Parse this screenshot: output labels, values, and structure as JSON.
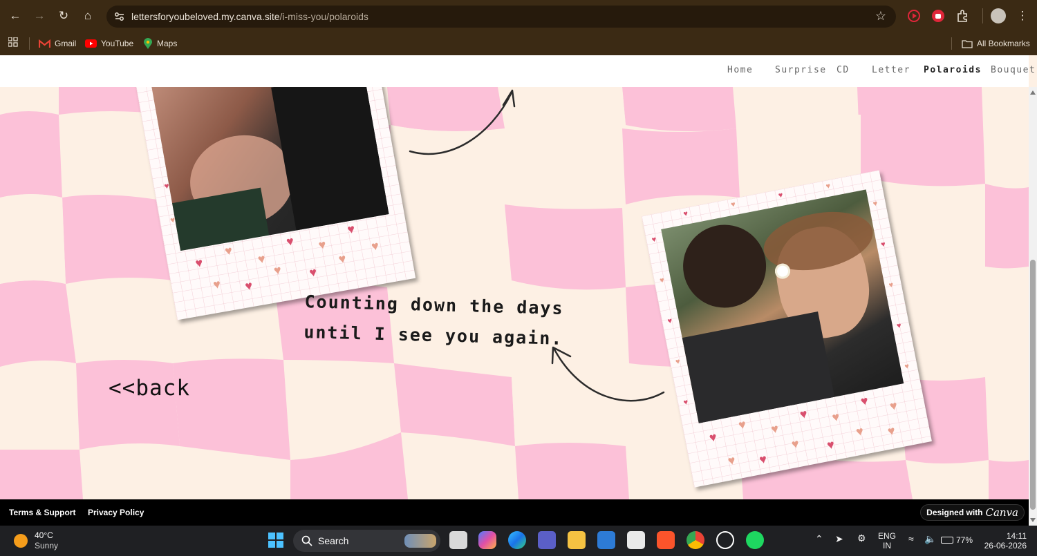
{
  "browser": {
    "url_host": "lettersforyoubeloved.my.canva.site",
    "url_path": "/i-miss-you/polaroids",
    "bookmarks": [
      "Gmail",
      "YouTube",
      "Maps"
    ],
    "all_bookmarks": "All Bookmarks"
  },
  "site_nav": {
    "items": [
      {
        "label": "Home",
        "active": false
      },
      {
        "label": "Surprise",
        "active": false
      },
      {
        "label": "CD",
        "active": false
      },
      {
        "label": "Letter",
        "active": false
      },
      {
        "label": "Polaroids",
        "active": true
      },
      {
        "label": "Bouquet",
        "active": false
      }
    ]
  },
  "page": {
    "caption_line1": "Counting down the days",
    "caption_line2": "until I see you again.",
    "back_link": "<<back",
    "colors": {
      "pink": "#fcc1d8",
      "cream": "#fdf0e4",
      "heart_red": "#d94f6e",
      "heart_peach": "#e8a08c"
    }
  },
  "footer": {
    "terms": "Terms & Support",
    "privacy": "Privacy Policy",
    "designed_with": "Designed with",
    "canva": "Canva"
  },
  "taskbar": {
    "temperature": "40°C",
    "condition": "Sunny",
    "search": "Search",
    "lang1": "ENG",
    "lang2": "IN",
    "battery": "77%",
    "time": "14:11",
    "date": "26-06-2026"
  }
}
